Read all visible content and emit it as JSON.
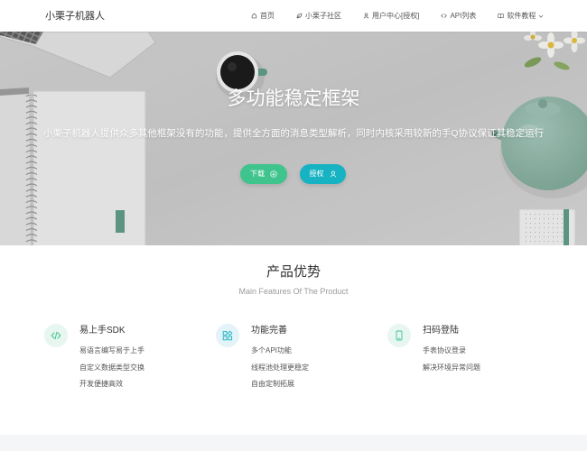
{
  "header": {
    "logo": "小栗子机器人",
    "nav": [
      {
        "label": "首页",
        "icon": "home-icon"
      },
      {
        "label": "小栗子社区",
        "icon": "community-icon"
      },
      {
        "label": "用户中心[授权]",
        "icon": "user-icon"
      },
      {
        "label": "API列表",
        "icon": "code-icon"
      },
      {
        "label": "软件教程",
        "icon": "book-icon",
        "has_dropdown": true,
        "dropdown_icon": "chevron-down-icon"
      }
    ]
  },
  "hero": {
    "title": "多功能稳定框架",
    "subtitle": "小栗子机器人提供众多其他框架没有的功能，提供全方面的消息类型解析，同时内核采用较新的手Q协议保证其稳定运行",
    "buttons": {
      "download": {
        "label": "下载",
        "icon": "download-icon",
        "color": "#3fc48e"
      },
      "auth": {
        "label": "授权",
        "icon": "user-icon",
        "color": "#17b3c3"
      }
    }
  },
  "features": {
    "title": "产品优势",
    "subtitle": "Main Features Of The Product",
    "items": [
      {
        "title": "易上手SDK",
        "icon": "code-icon",
        "icon_color": "#3fc48e",
        "icon_bg": "#e7f6f0",
        "points": [
          "易语言编写易于上手",
          "自定义数据类型交换",
          "开发便捷高效"
        ]
      },
      {
        "title": "功能完善",
        "icon": "widgets-icon",
        "icon_color": "#17b3c3",
        "icon_bg": "#e4f3f8",
        "points": [
          "多个API功能",
          "线程池处理更稳定",
          "自由定制拓展"
        ]
      },
      {
        "title": "扫码登陆",
        "icon": "phone-icon",
        "icon_color": "#3fc48e",
        "icon_bg": "#e7f6f0",
        "points": [
          "手表协议登录",
          "解决环境异常问题"
        ]
      }
    ]
  },
  "colors": {
    "primary_green": "#3fc48e",
    "accent_teal": "#17b3c3",
    "footer_band": "#f4f6f7"
  }
}
